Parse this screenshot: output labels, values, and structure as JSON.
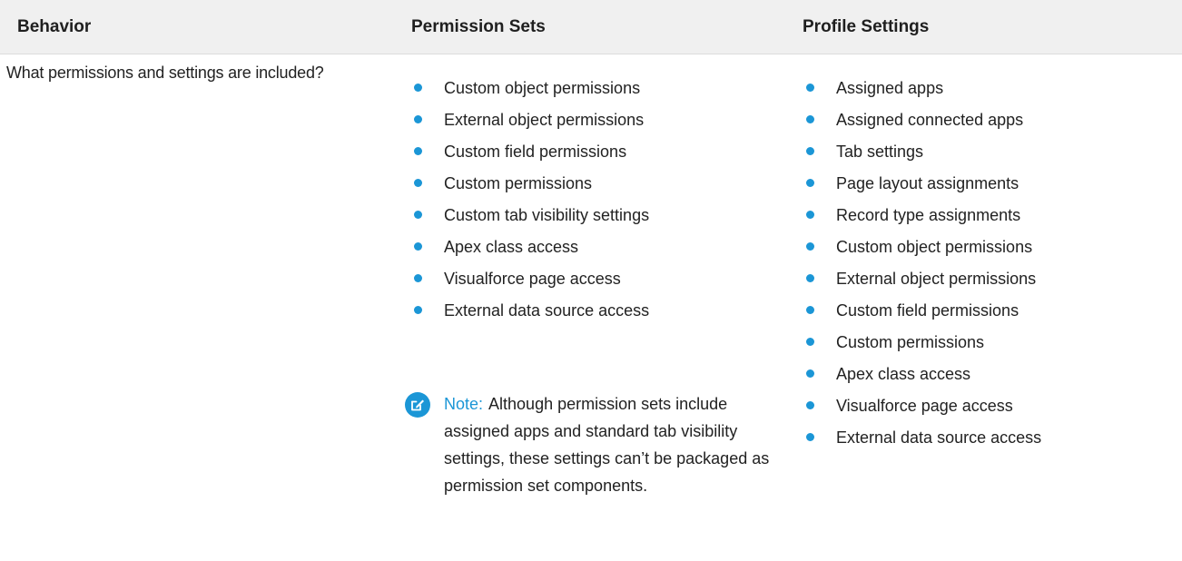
{
  "headers": {
    "behavior": "Behavior",
    "permission_sets": "Permission Sets",
    "profile_settings": "Profile Settings"
  },
  "rows": [
    {
      "behavior": "What permissions and settings are included?",
      "permission_sets": [
        "Custom object permissions",
        "External object permissions",
        "Custom field permissions",
        "Custom permissions",
        "Custom tab visibility settings",
        "Apex class access",
        "Visualforce page access",
        "External data source access"
      ],
      "note": {
        "icon": "edit-note-icon",
        "label": "Note:",
        "text": "Although permission sets include assigned apps and standard tab visibility settings, these settings can’t be packaged as permission set components."
      },
      "profile_settings": [
        "Assigned apps",
        "Assigned connected apps",
        "Tab settings",
        "Page layout assignments",
        "Record type assignments",
        "Custom object permissions",
        "External object permissions",
        "Custom field permissions",
        "Custom permissions",
        "Apex class access",
        "Visualforce page access",
        "External data source access"
      ]
    }
  ],
  "colors": {
    "accent": "#1b96d6",
    "header_bg": "#f0f0f0"
  }
}
